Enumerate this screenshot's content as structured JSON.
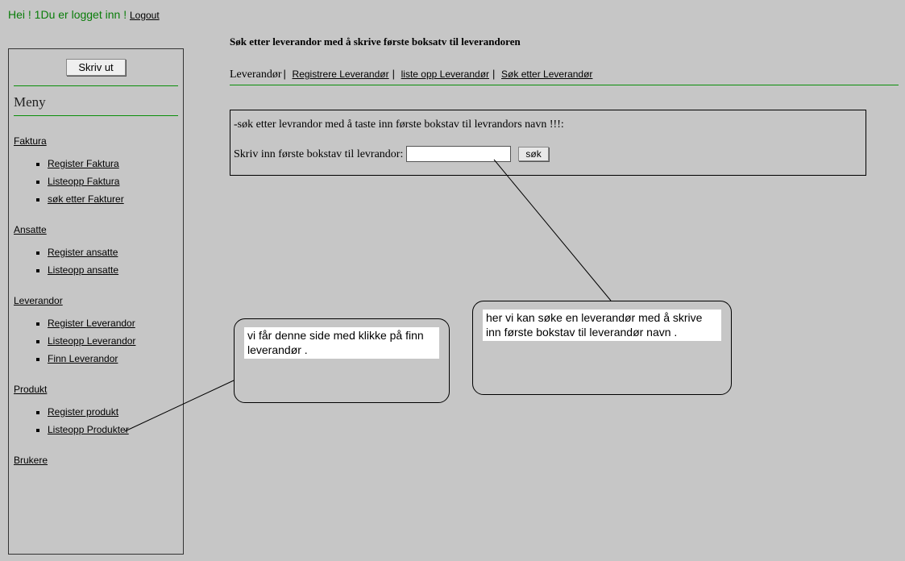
{
  "header": {
    "greeting_prefix": "Hei ! 1",
    "logged_in_text": "Du er logget inn !",
    "logout_label": "Logout"
  },
  "sidebar": {
    "print_label": "Skriv ut",
    "menu_title": "Meny",
    "sections": [
      {
        "title": "Faktura",
        "items": [
          "Register Faktura",
          "Listeopp Faktura",
          "søk etter Fakturer"
        ]
      },
      {
        "title": "Ansatte",
        "items": [
          "Register ansatte",
          "Listeopp ansatte"
        ]
      },
      {
        "title": "Leverandor",
        "items": [
          "Register Leverandor",
          "Listeopp Leverandor",
          "Finn Leverandor"
        ]
      },
      {
        "title": "Produkt",
        "items": [
          "Register produkt",
          "Listeopp Produkter"
        ]
      },
      {
        "title": "Brukere",
        "items": []
      }
    ]
  },
  "main": {
    "page_title": "Søk etter leverandor med å skrive første boksatv til leverandoren",
    "crumbs": {
      "lead": "Leverandør",
      "links": [
        "Registrere Leverandør",
        "liste opp Leverandør",
        "Søk etter Leverandør"
      ]
    },
    "search_box": {
      "instruction": "-søk etter levrandor med å taste inn første bokstav til levrandors navn !!!:",
      "label": "Skriv inn første bokstav til levrandor:",
      "input_value": "",
      "button_label": "søk"
    }
  },
  "callouts": {
    "c1": "vi får denne side  med klikke på finn leverandør .",
    "c2": "her  vi  kan søke en leverandør med å skrive inn første  bokstav til leverandør navn ."
  }
}
